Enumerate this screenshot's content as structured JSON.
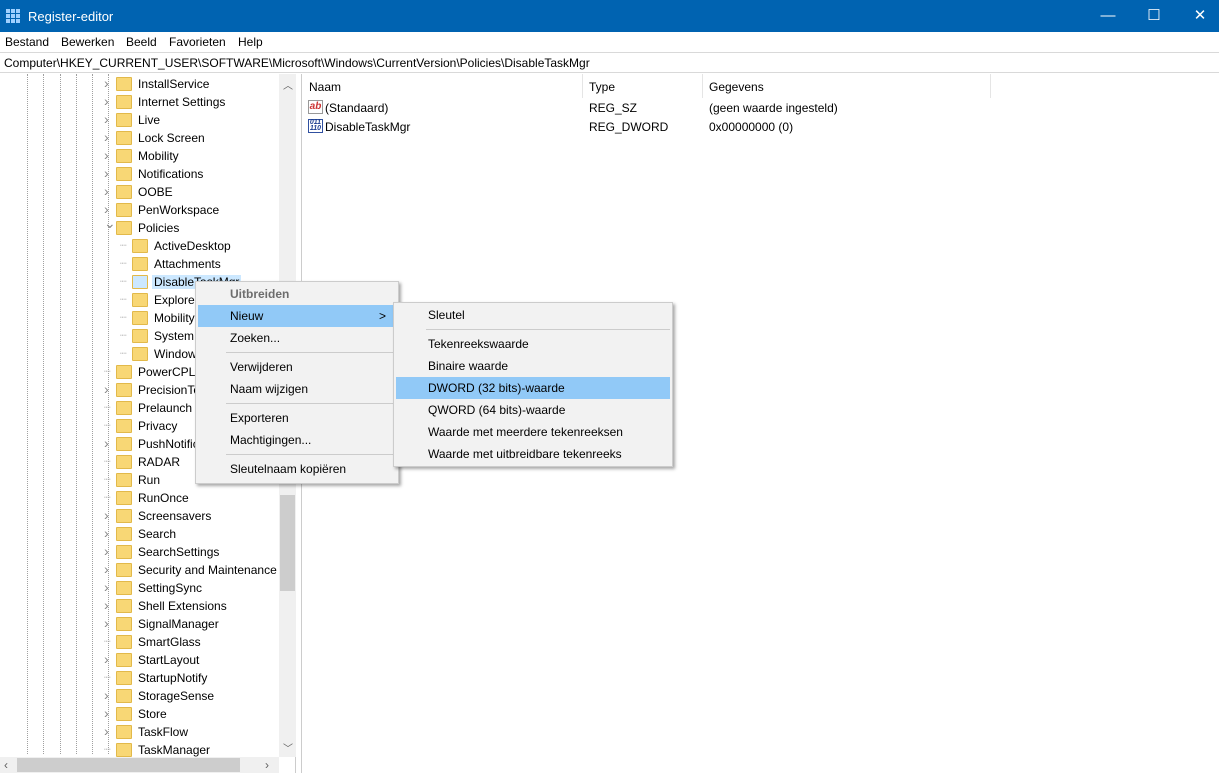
{
  "window": {
    "title": "Register-editor",
    "minimize": "—",
    "maximize": "☐",
    "close": "✕",
    "accent": "#0063b1"
  },
  "menubar": [
    "Bestand",
    "Bewerken",
    "Beeld",
    "Favorieten",
    "Help"
  ],
  "address": "Computer\\HKEY_CURRENT_USER\\SOFTWARE\\Microsoft\\Windows\\CurrentVersion\\Policies\\DisableTaskMgr",
  "tree": [
    {
      "label": "InstallService",
      "level": 1,
      "expander": "closed"
    },
    {
      "label": "Internet Settings",
      "level": 1,
      "expander": "closed"
    },
    {
      "label": "Live",
      "level": 1,
      "expander": "closed"
    },
    {
      "label": "Lock Screen",
      "level": 1,
      "expander": "closed"
    },
    {
      "label": "Mobility",
      "level": 1,
      "expander": "closed"
    },
    {
      "label": "Notifications",
      "level": 1,
      "expander": "closed"
    },
    {
      "label": "OOBE",
      "level": 1,
      "expander": "closed"
    },
    {
      "label": "PenWorkspace",
      "level": 1,
      "expander": "closed"
    },
    {
      "label": "Policies",
      "level": 1,
      "expander": "open"
    },
    {
      "label": "ActiveDesktop",
      "level": 2,
      "expander": "none"
    },
    {
      "label": "Attachments",
      "level": 2,
      "expander": "none"
    },
    {
      "label": "DisableTaskMgr",
      "level": 2,
      "expander": "none",
      "selected": true
    },
    {
      "label": "Explorer",
      "level": 2,
      "expander": "none"
    },
    {
      "label": "Mobility",
      "level": 2,
      "expander": "none"
    },
    {
      "label": "System",
      "level": 2,
      "expander": "none"
    },
    {
      "label": "Windows",
      "level": 2,
      "expander": "none"
    },
    {
      "label": "PowerCPL",
      "level": 1,
      "expander": "none"
    },
    {
      "label": "PrecisionTouchPad",
      "level": 1,
      "expander": "closed"
    },
    {
      "label": "Prelaunch",
      "level": 1,
      "expander": "none"
    },
    {
      "label": "Privacy",
      "level": 1,
      "expander": "none"
    },
    {
      "label": "PushNotifications",
      "level": 1,
      "expander": "closed"
    },
    {
      "label": "RADAR",
      "level": 1,
      "expander": "none"
    },
    {
      "label": "Run",
      "level": 1,
      "expander": "none"
    },
    {
      "label": "RunOnce",
      "level": 1,
      "expander": "none"
    },
    {
      "label": "Screensavers",
      "level": 1,
      "expander": "closed"
    },
    {
      "label": "Search",
      "level": 1,
      "expander": "closed"
    },
    {
      "label": "SearchSettings",
      "level": 1,
      "expander": "closed"
    },
    {
      "label": "Security and Maintenance",
      "level": 1,
      "expander": "closed"
    },
    {
      "label": "SettingSync",
      "level": 1,
      "expander": "closed"
    },
    {
      "label": "Shell Extensions",
      "level": 1,
      "expander": "closed"
    },
    {
      "label": "SignalManager",
      "level": 1,
      "expander": "closed"
    },
    {
      "label": "SmartGlass",
      "level": 1,
      "expander": "none"
    },
    {
      "label": "StartLayout",
      "level": 1,
      "expander": "closed"
    },
    {
      "label": "StartupNotify",
      "level": 1,
      "expander": "none"
    },
    {
      "label": "StorageSense",
      "level": 1,
      "expander": "closed"
    },
    {
      "label": "Store",
      "level": 1,
      "expander": "closed"
    },
    {
      "label": "TaskFlow",
      "level": 1,
      "expander": "closed"
    },
    {
      "label": "TaskManager",
      "level": 1,
      "expander": "none"
    }
  ],
  "list": {
    "columns": [
      "Naam",
      "Type",
      "Gegevens"
    ],
    "rows": [
      {
        "icon": "string-value-icon",
        "icon_text": "ab",
        "name": "(Standaard)",
        "type": "REG_SZ",
        "data": "(geen waarde ingesteld)"
      },
      {
        "icon": "binary-value-icon",
        "icon_text": "011 110",
        "name": "DisableTaskMgr",
        "type": "REG_DWORD",
        "data": "0x00000000 (0)"
      }
    ]
  },
  "context_menu": {
    "items": [
      {
        "label": "Uitbreiden",
        "disabled": true
      },
      {
        "label": "Nieuw",
        "highlighted": true,
        "submenu_arrow": ">"
      },
      {
        "label": "Zoeken..."
      },
      {
        "separator": true
      },
      {
        "label": "Verwijderen"
      },
      {
        "label": "Naam wijzigen"
      },
      {
        "separator": true
      },
      {
        "label": "Exporteren"
      },
      {
        "label": "Machtigingen..."
      },
      {
        "separator": true
      },
      {
        "label": "Sleutelnaam kopiëren"
      }
    ]
  },
  "submenu": {
    "items": [
      {
        "label": "Sleutel"
      },
      {
        "separator": true
      },
      {
        "label": "Tekenreekswaarde"
      },
      {
        "label": "Binaire waarde"
      },
      {
        "label": "DWORD (32 bits)-waarde",
        "highlighted": true
      },
      {
        "label": "QWORD (64 bits)-waarde"
      },
      {
        "label": "Waarde met meerdere tekenreeksen"
      },
      {
        "label": "Waarde met uitbreidbare tekenreeks"
      }
    ]
  },
  "highlight_color": "#91c9f7"
}
